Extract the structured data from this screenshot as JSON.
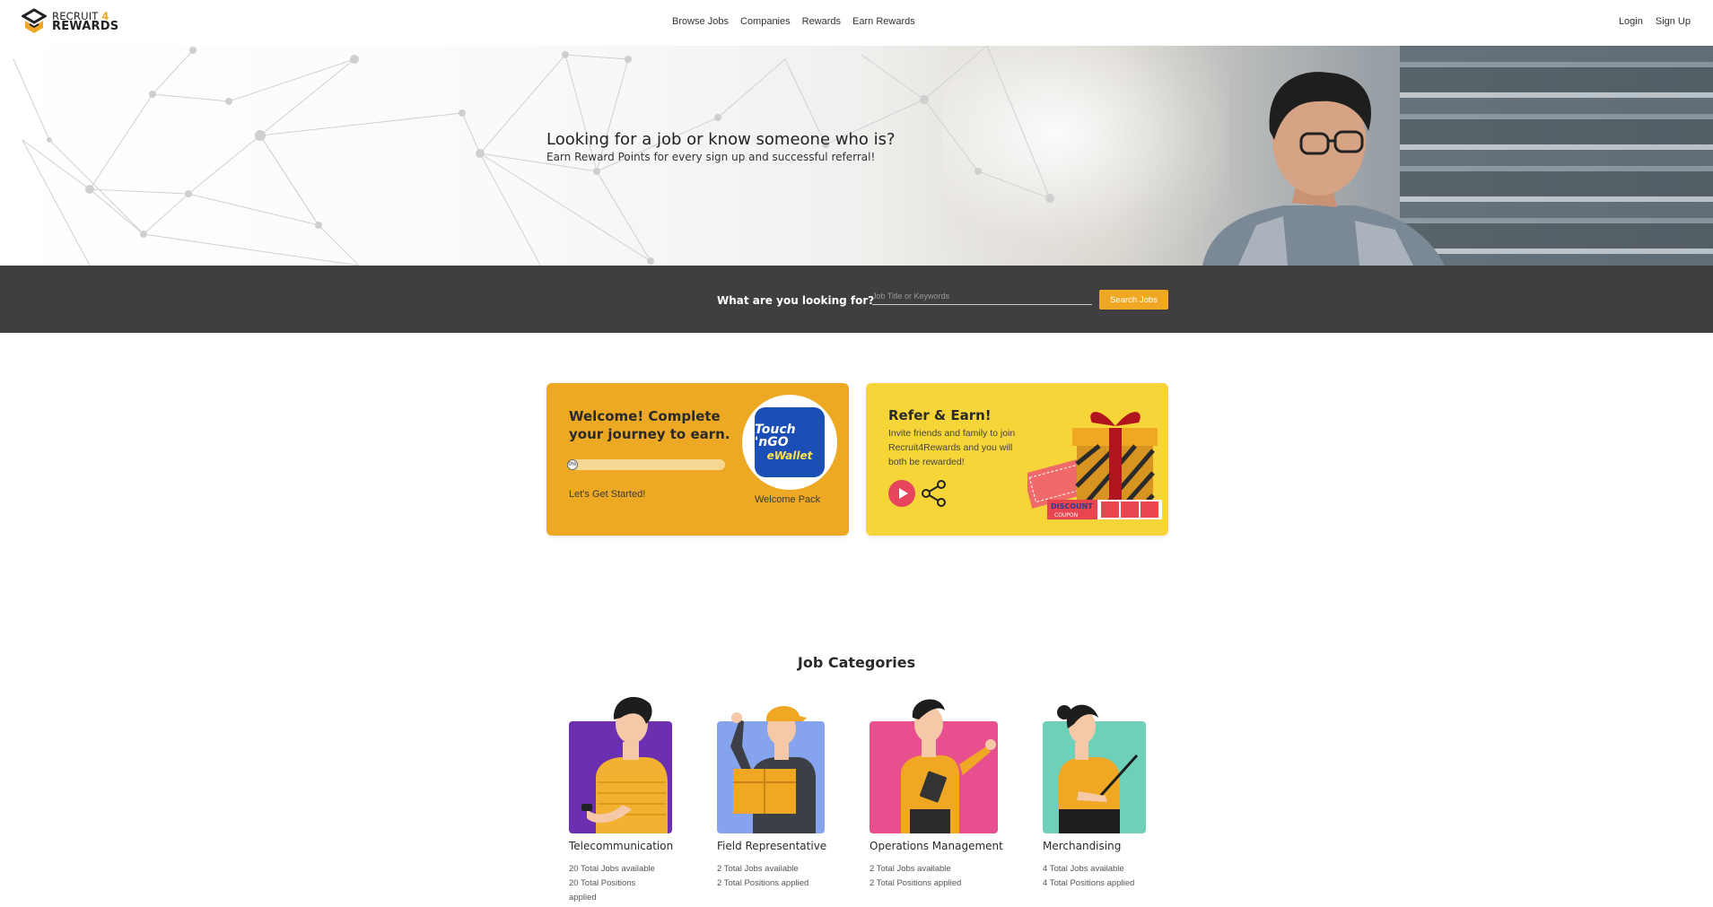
{
  "brand": {
    "line1": "RECRUIT",
    "line1_num": "4",
    "line2": "REWARDS",
    "accent": "#f0a824"
  },
  "nav": [
    "Browse Jobs",
    "Companies",
    "Rewards",
    "Earn Rewards"
  ],
  "auth": {
    "login": "Login",
    "signup": "Sign Up"
  },
  "hero": {
    "title": "Looking for a job or know someone who is?",
    "subtitle": "Earn Reward Points for every sign up and successful referral!"
  },
  "search": {
    "label": "What are you looking for?",
    "placeholder": "Job Title or Keywords",
    "value": "",
    "button": "Search Jobs"
  },
  "welcome_card": {
    "title": "Welcome! Complete your journey to earn.",
    "progress_percent": 0,
    "progress_text": "0%",
    "cta": "Let's Get Started!",
    "reward_logo_line1": "Touch 'nGO",
    "reward_logo_line2": "eWallet",
    "reward_label": "Welcome Pack",
    "bg_color": "#eda923"
  },
  "refer_card": {
    "title": "Refer & Earn!",
    "description": "Invite friends and family to join Recruit4Rewards and you will both be rewarded!",
    "coupon_text": "DISCOUNT COUPON",
    "bg_color": "#f6d538"
  },
  "job_categories": {
    "title": "Job Categories",
    "items": [
      {
        "name": "Telecommunication",
        "jobs": "20 Total Jobs available",
        "positions_line1": "20 Total Positions",
        "positions_line2": "applied",
        "color": "#6b2fb0"
      },
      {
        "name": "Field Representative",
        "jobs": "2 Total Jobs available",
        "positions_line1": "2 Total Positions applied",
        "positions_line2": "",
        "color": "#86a3ee"
      },
      {
        "name": "Operations Management",
        "jobs": "2 Total Jobs available",
        "positions_line1": "2 Total Positions applied",
        "positions_line2": "",
        "color": "#e84f8e"
      },
      {
        "name": "Merchandising",
        "jobs": "4 Total Jobs available",
        "positions_line1": "4 Total Positions applied",
        "positions_line2": "",
        "color": "#6fd0b9"
      }
    ]
  }
}
